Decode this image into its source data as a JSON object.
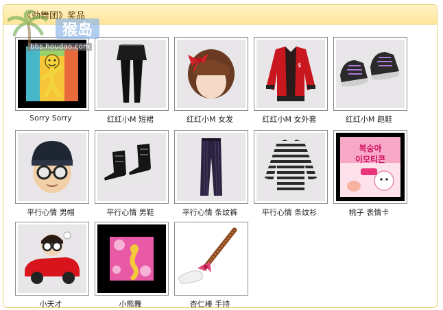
{
  "header": {
    "title": "《劲舞团》奖品"
  },
  "watermark": {
    "site_text": "bbs.houdao.com",
    "logo_text": "猴岛"
  },
  "items": [
    {
      "label": "Sorry Sorry",
      "icon": "dance-emote-icon"
    },
    {
      "label": "红红小M 短裙",
      "icon": "skirt-leggings-icon"
    },
    {
      "label": "红红小M 女发",
      "icon": "bob-hair-icon"
    },
    {
      "label": "红红小M 女外套",
      "icon": "red-jacket-icon"
    },
    {
      "label": "红红小M 跑鞋",
      "icon": "sneakers-icon"
    },
    {
      "label": "平行心情 男帽",
      "icon": "beanie-glasses-icon"
    },
    {
      "label": "平行心情 男鞋",
      "icon": "black-boots-icon"
    },
    {
      "label": "平行心情 条纹裤",
      "icon": "striped-pants-icon"
    },
    {
      "label": "平行心情 条纹衫",
      "icon": "striped-shirt-icon"
    },
    {
      "label": "桃子 表情卡",
      "icon": "emoticon-card-icon",
      "card_text": "복숭아\n이모티콘"
    },
    {
      "label": "小天才",
      "icon": "genius-car-icon"
    },
    {
      "label": "小熊舞",
      "icon": "bear-dance-icon"
    },
    {
      "label": "杏仁棒 手持",
      "icon": "almond-stick-icon"
    }
  ]
}
